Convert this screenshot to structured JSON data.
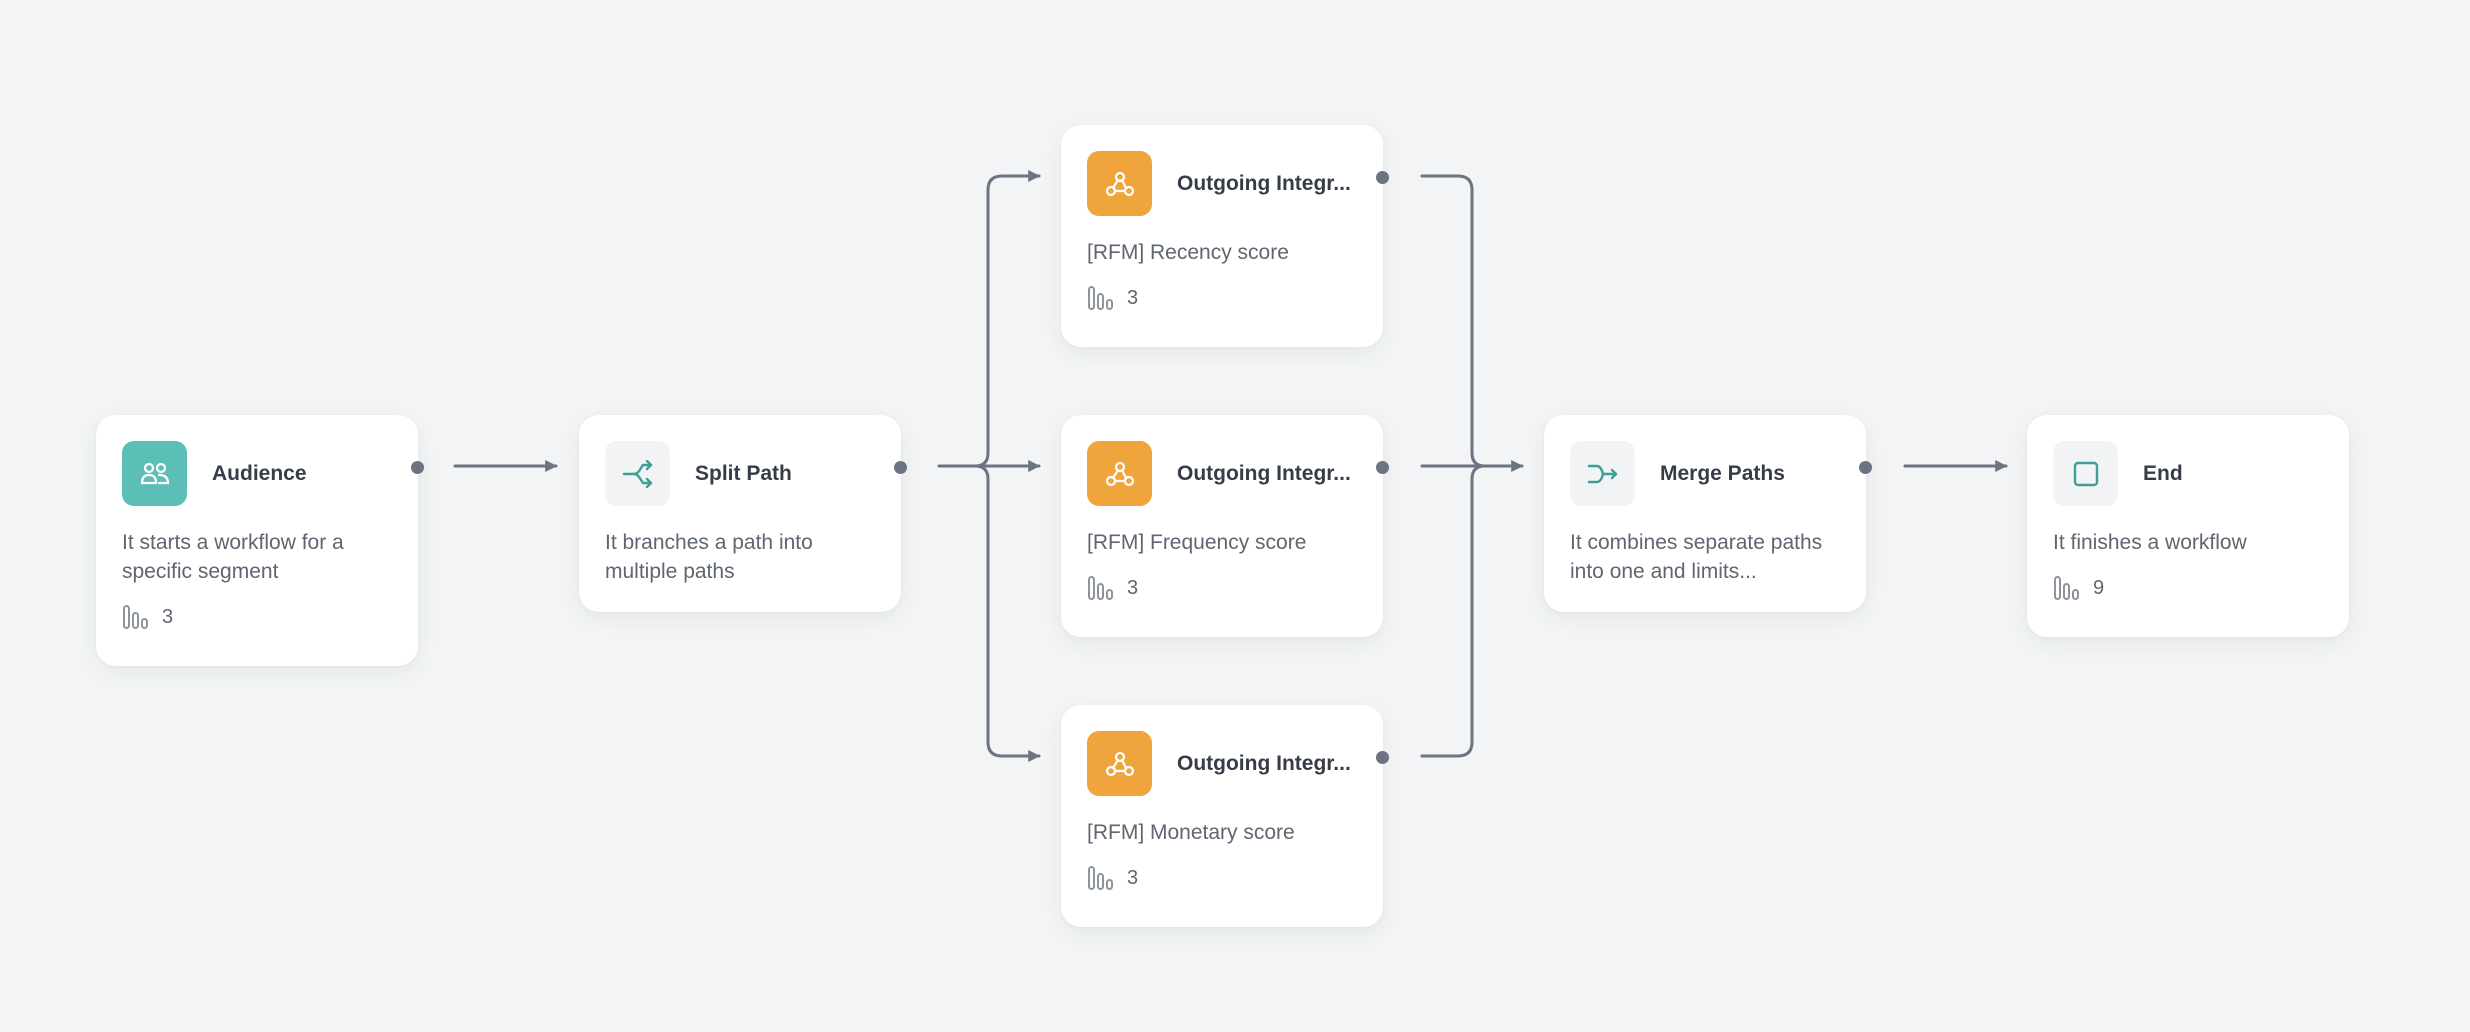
{
  "diagram": {
    "nodes": [
      {
        "id": "audience",
        "title": "Audience",
        "icon": "audience-icon",
        "icon_style": "teal",
        "description": "It starts a workflow for a specific segment",
        "stat_icon": "stats-icon",
        "count": "3"
      },
      {
        "id": "split",
        "title": "Split Path",
        "icon": "split-path-icon",
        "icon_style": "light",
        "description": "It branches a path into multiple paths"
      },
      {
        "id": "out1",
        "title": "Outgoing Integration",
        "title_display": "Outgoing Integr...",
        "icon": "webhook-icon",
        "icon_style": "orange",
        "description": "[RFM] Recency score",
        "stat_icon": "stats-icon",
        "count": "3"
      },
      {
        "id": "out2",
        "title": "Outgoing Integration",
        "title_display": "Outgoing Integr...",
        "icon": "webhook-icon",
        "icon_style": "orange",
        "description": "[RFM] Frequency score",
        "stat_icon": "stats-icon",
        "count": "3"
      },
      {
        "id": "out3",
        "title": "Outgoing Integration",
        "title_display": "Outgoing Integr...",
        "icon": "webhook-icon",
        "icon_style": "orange",
        "description": "[RFM] Monetary score",
        "stat_icon": "stats-icon",
        "count": "3"
      },
      {
        "id": "merge",
        "title": "Merge Paths",
        "icon": "merge-paths-icon",
        "icon_style": "light",
        "description": "It combines separate paths into one and limits..."
      },
      {
        "id": "end",
        "title": "End",
        "icon": "end-square-icon",
        "icon_style": "light",
        "description": "It finishes a workflow",
        "stat_icon": "stats-icon",
        "count": "9"
      }
    ],
    "edges": [
      {
        "from": "audience",
        "to": "split"
      },
      {
        "from": "split",
        "to": "out1"
      },
      {
        "from": "split",
        "to": "out2"
      },
      {
        "from": "split",
        "to": "out3"
      },
      {
        "from": "out1",
        "to": "merge"
      },
      {
        "from": "out2",
        "to": "merge"
      },
      {
        "from": "out3",
        "to": "merge"
      },
      {
        "from": "merge",
        "to": "end"
      }
    ],
    "colors": {
      "background": "#f2f4f5",
      "card": "#ffffff",
      "teal": "#5bbfb8",
      "orange": "#f0a53c",
      "connector": "#6b7480",
      "title_text": "#363d47",
      "body_text": "#5e6671"
    }
  }
}
